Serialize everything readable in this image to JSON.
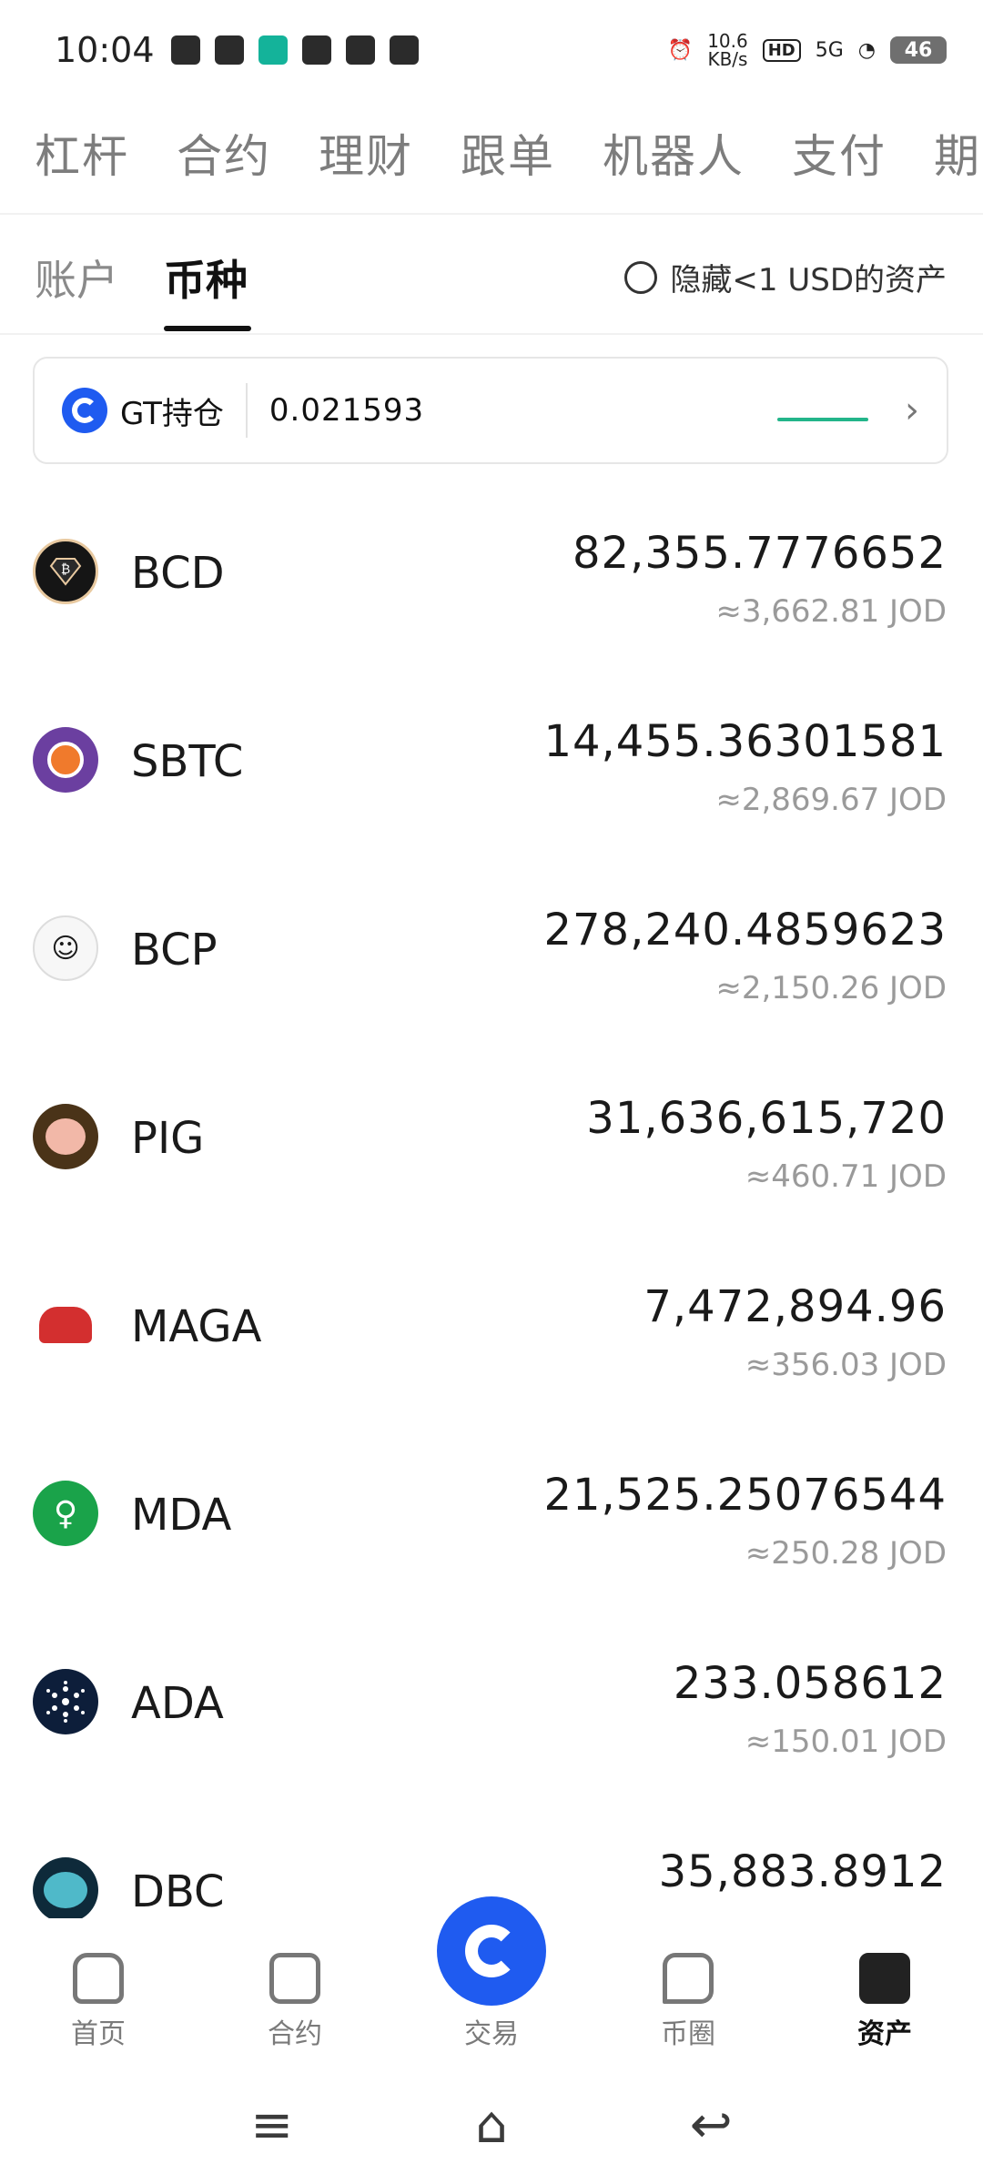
{
  "status_bar": {
    "time": "10:04",
    "net_speed_value": "10.6",
    "net_speed_unit": "KB/s",
    "hd": "HD",
    "network": "5G",
    "battery": "46"
  },
  "top_nav": [
    "杠杆",
    "合约",
    "理财",
    "跟单",
    "机器人",
    "支付",
    "期"
  ],
  "sub_tabs": {
    "account": "账户",
    "coin": "币种"
  },
  "hide_small": "隐藏<1 USD的资产",
  "gt_card": {
    "label": "GT持仓",
    "value": "0.021593"
  },
  "assets": [
    {
      "name": "BCD",
      "amount": "82,355.7776652",
      "value": "≈3,662.81 JOD",
      "icon": "bcd-icon",
      "color": "#1a1a1a"
    },
    {
      "name": "SBTC",
      "amount": "14,455.36301581",
      "value": "≈2,869.67 JOD",
      "icon": "sbtc-icon",
      "color": "#6b3fa0"
    },
    {
      "name": "BCP",
      "amount": "278,240.4859623",
      "value": "≈2,150.26 JOD",
      "icon": "bcp-icon",
      "color": "#f2f2f2"
    },
    {
      "name": "PIG",
      "amount": "31,636,615,720",
      "value": "≈460.71 JOD",
      "icon": "pig-icon",
      "color": "#4a3318"
    },
    {
      "name": "MAGA",
      "amount": "7,472,894.96",
      "value": "≈356.03 JOD",
      "icon": "maga-icon",
      "color": "#d32f2f"
    },
    {
      "name": "MDA",
      "amount": "21,525.25076544",
      "value": "≈250.28 JOD",
      "icon": "mda-icon",
      "color": "#1aa34a"
    },
    {
      "name": "ADA",
      "amount": "233.058612",
      "value": "≈150.01 JOD",
      "icon": "ada-icon",
      "color": "#0d1e3a"
    },
    {
      "name": "DBC",
      "amount": "35,883.8912",
      "value": "",
      "icon": "dbc-icon",
      "color": "#0e2a3a"
    }
  ],
  "bottom_nav": {
    "home": "首页",
    "contract": "合约",
    "trade": "交易",
    "community": "币圈",
    "assets": "资产"
  }
}
